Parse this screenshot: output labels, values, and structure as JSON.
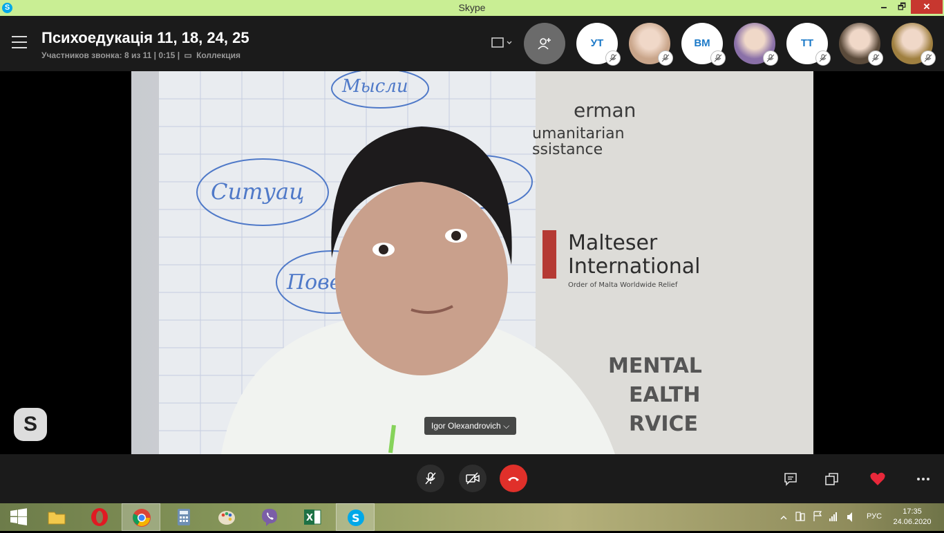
{
  "window": {
    "title": "Skype",
    "minimize": "🗕",
    "maximize": "🗗",
    "close": "✕"
  },
  "header": {
    "call_title": "Психоедукація 11, 18, 24, 25",
    "call_status": "Участников звонка: 8 из 11 | 0:15 |",
    "collection_label": "Коллекция"
  },
  "participants": [
    {
      "initials": "УТ",
      "type": "initials"
    },
    {
      "initials": "",
      "type": "photo",
      "color": "#c9a58a"
    },
    {
      "initials": "ВМ",
      "type": "initials"
    },
    {
      "initials": "",
      "type": "photo",
      "color": "#8a70a8"
    },
    {
      "initials": "ТТ",
      "type": "initials"
    },
    {
      "initials": "",
      "type": "photo",
      "color": "#5a4a3a"
    },
    {
      "initials": "",
      "type": "photo",
      "color": "#a08040"
    }
  ],
  "video": {
    "speaker_name": "Igor Olexandrovich",
    "board_words": [
      "Мысли",
      "Ситуац",
      "Пове"
    ],
    "banner_lines": [
      "erman",
      "umanitarian",
      "ssistance",
      "Malteser",
      "International",
      "Order of Malta Worldwide Relief",
      "MENTAL",
      "EALTH",
      "RVICE"
    ]
  },
  "taskbar": {
    "apps": [
      "file-explorer",
      "opera",
      "chrome",
      "calculator",
      "paint",
      "viber",
      "excel",
      "skype"
    ],
    "language": "РУС",
    "time": "17:35",
    "date": "24.06.2020"
  },
  "colors": {
    "accent": "#1d7ac8",
    "hangup": "#e0302a",
    "heart": "#e8283a",
    "titlebar": "#c9ee94"
  }
}
